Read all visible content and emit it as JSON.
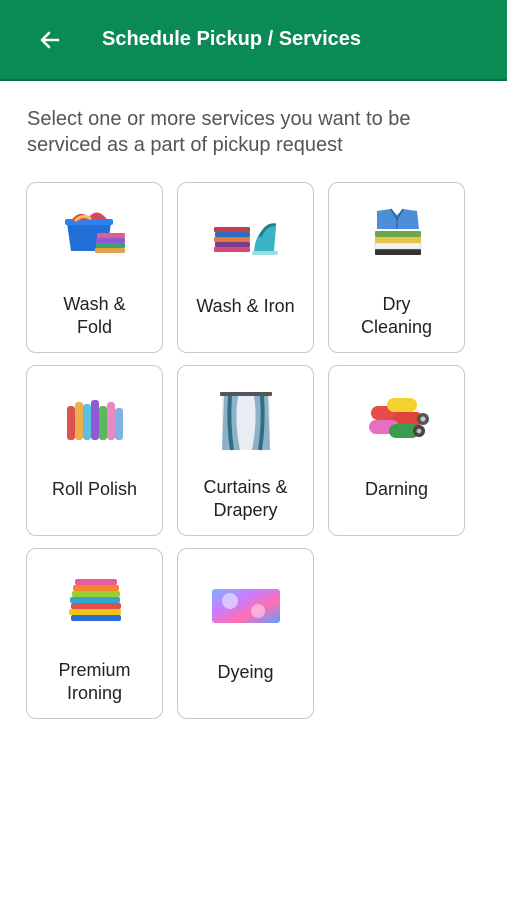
{
  "header": {
    "title": "Schedule Pickup / Services",
    "back_icon": "arrow-left-icon",
    "background": "#0a8a55"
  },
  "intro": "Select one or more services you want to be serviced as a part of pickup request",
  "services": [
    {
      "label": "Wash & Fold",
      "line1": "Wash &",
      "line2": "Fold",
      "icon": "laundry-basket-icon"
    },
    {
      "label": "Wash & Iron",
      "line1": "Wash & Iron",
      "line2": "",
      "icon": "iron-clothes-icon"
    },
    {
      "label": "Dry Cleaning",
      "line1": "Dry",
      "line2": "Cleaning",
      "icon": "folded-shirts-icon"
    },
    {
      "label": "Roll Polish",
      "line1": "Roll Polish",
      "line2": "",
      "icon": "fabric-rolls-icon"
    },
    {
      "label": "Curtains & Drapery",
      "line1": "Curtains &",
      "line2": "Drapery",
      "icon": "curtains-icon"
    },
    {
      "label": "Darning",
      "line1": "Darning",
      "line2": "",
      "icon": "thread-spools-icon"
    },
    {
      "label": "Premium Ironing",
      "line1": "Premium",
      "line2": "Ironing",
      "icon": "towel-stack-icon"
    },
    {
      "label": "Dyeing",
      "line1": "Dyeing",
      "line2": "",
      "icon": "dye-fabric-icon"
    }
  ]
}
